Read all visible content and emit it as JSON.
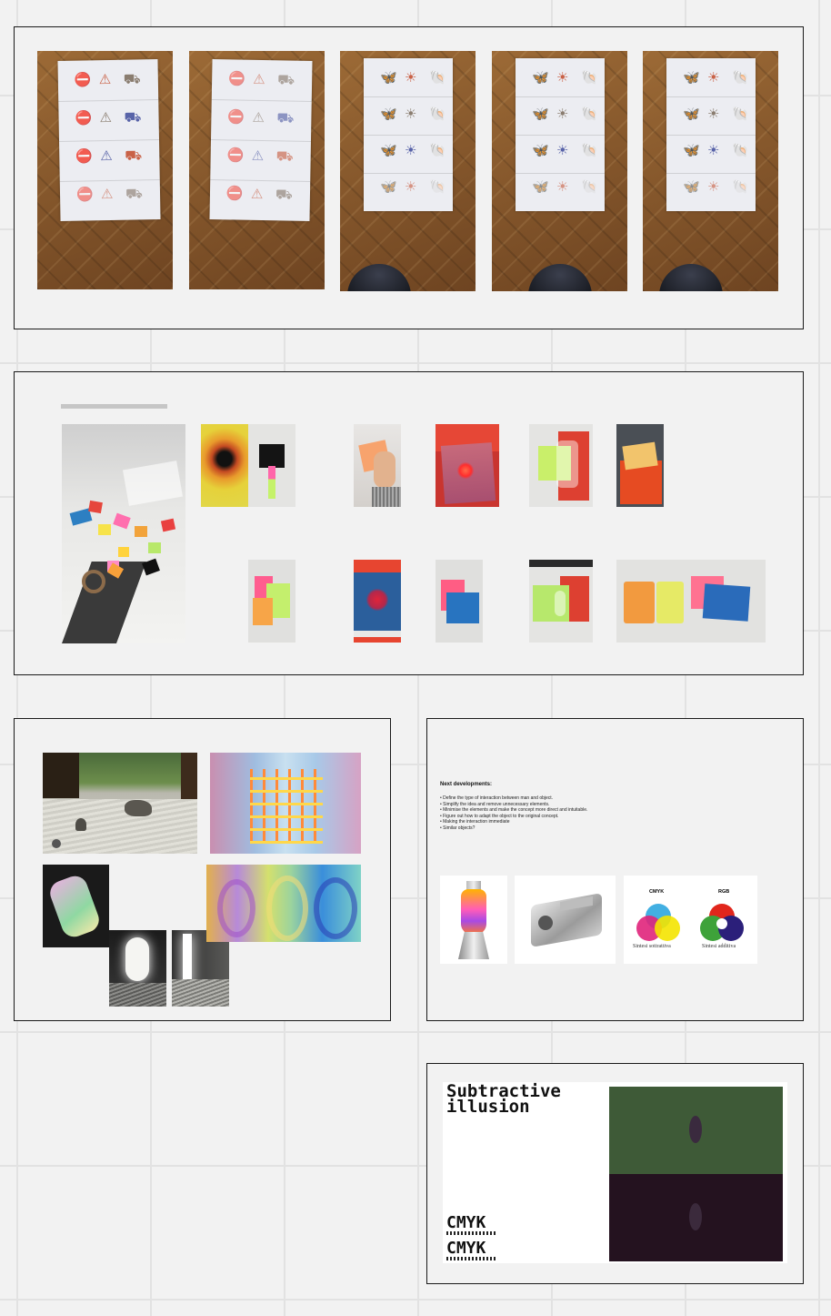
{
  "canvas": {
    "background": "#f2f2f2",
    "grid_color": "#e2e2e2"
  },
  "board1": {
    "photos": [
      {
        "label": "paper-sheet-signs-1",
        "icons": [
          "sign-icon",
          "warning-icon",
          "trolley-icon"
        ]
      },
      {
        "label": "paper-sheet-signs-2",
        "icons": [
          "sign-icon",
          "warning-icon",
          "trolley-icon"
        ]
      },
      {
        "label": "paper-sheet-butterflies-1",
        "icons": [
          "butterfly-icon",
          "sun-icon",
          "shell-icon"
        ]
      },
      {
        "label": "paper-sheet-butterflies-2",
        "icons": [
          "butterfly-icon",
          "sun-icon",
          "shell-icon"
        ]
      },
      {
        "label": "paper-sheet-butterflies-3",
        "icons": [
          "butterfly-icon",
          "sun-icon",
          "shell-icon"
        ]
      }
    ]
  },
  "board2": {
    "header_bar_color": "#c6c6c6"
  },
  "board4": {
    "title": "Next developments:",
    "items": [
      "• Define the type of interaction between man and object.",
      "• Simplify the idea and remove unnecessary elements.",
      "• Minimise the elements and make the concept more direct and intuitable.",
      "• Figure out how to adapt the object to the original concept.",
      "• Making the interaction immediate",
      "• Similar objects?"
    ],
    "cmyk_label": "CMYK",
    "rgb_label": "RGB",
    "cmyk_caption": "Sintesi sottrattiva",
    "rgb_caption": "Sintesi additiva"
  },
  "board5": {
    "title_line1": "Subtractive",
    "title_line2": "illusion",
    "cmyk_1": "CMYK",
    "cmyk_2": "CMYK",
    "top_color": "#3e5a37",
    "bottom_color": "#24121f"
  }
}
